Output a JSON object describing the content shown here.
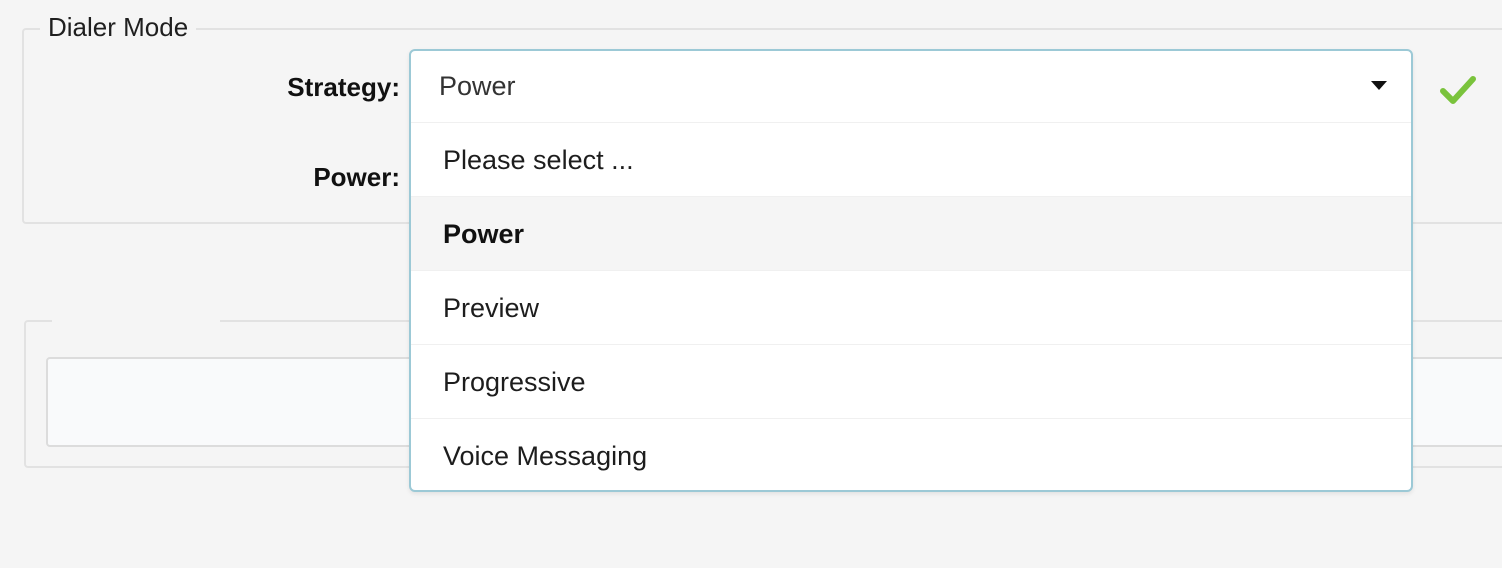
{
  "dialer_mode": {
    "legend": "Dialer Mode",
    "strategy_label": "Strategy:",
    "power_label": "Power:"
  },
  "strategy_select": {
    "value": "Power",
    "options": [
      {
        "label": "Please select ..."
      },
      {
        "label": "Power",
        "selected": true
      },
      {
        "label": "Preview"
      },
      {
        "label": "Progressive"
      },
      {
        "label": "Voice Messaging"
      }
    ]
  },
  "icons": {
    "caret": "caret-down-icon",
    "valid": "checkmark-icon"
  },
  "colors": {
    "check_green": "#7ac33c",
    "dropdown_border": "#9cc9d6",
    "selected_option_bg": "#f5f5f5"
  }
}
